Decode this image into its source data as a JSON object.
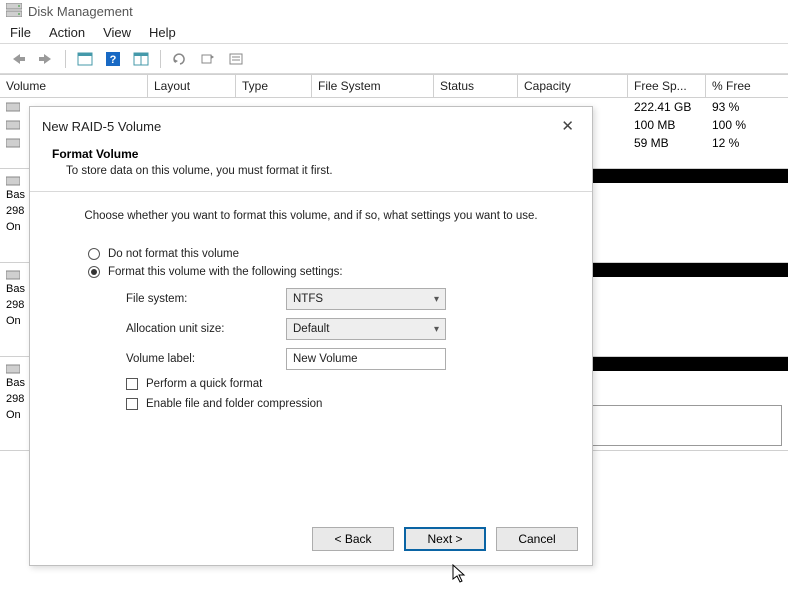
{
  "window": {
    "title": "Disk Management"
  },
  "menu": {
    "file": "File",
    "action": "Action",
    "view": "View",
    "help": "Help"
  },
  "table": {
    "headers": {
      "volume": "Volume",
      "layout": "Layout",
      "type": "Type",
      "fs": "File System",
      "status": "Status",
      "capacity": "Capacity",
      "free": "Free Sp...",
      "pct": "% Free"
    },
    "rows": [
      {
        "free": "222.41 GB",
        "pct": "93 %"
      },
      {
        "free": "100 MB",
        "pct": "100 %"
      },
      {
        "free": "59 MB",
        "pct": "12 %"
      }
    ]
  },
  "disk_panes": [
    {
      "line1": "Bas",
      "line2": "298",
      "line3": "On"
    },
    {
      "line1": "Bas",
      "line2": "298",
      "line3": "On"
    },
    {
      "line1": "Bas",
      "line2": "298",
      "line3": "On"
    }
  ],
  "wizard": {
    "title": "New RAID-5 Volume",
    "h1": "Format Volume",
    "h2": "To store data on this volume, you must format it first.",
    "intro": "Choose whether you want to format this volume, and if so, what settings you want to use.",
    "opt_no_format": "Do not format this volume",
    "opt_format": "Format this volume with the following settings:",
    "labels": {
      "fs": "File system:",
      "alloc": "Allocation unit size:",
      "label": "Volume label:",
      "quick": "Perform a quick format",
      "compress": "Enable file and folder compression"
    },
    "values": {
      "fs": "NTFS",
      "alloc": "Default",
      "label": "New Volume"
    },
    "buttons": {
      "back": "< Back",
      "next": "Next >",
      "cancel": "Cancel"
    }
  }
}
